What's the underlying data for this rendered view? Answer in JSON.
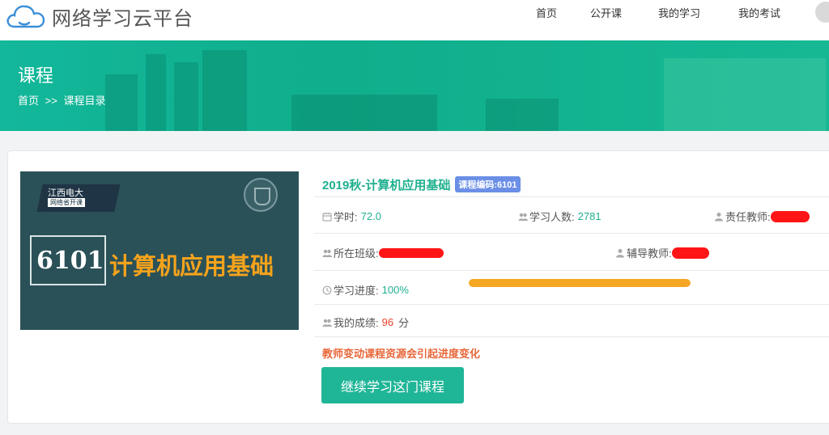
{
  "site": {
    "name": "网络学习云平台",
    "logo_icon": "cloud-icon"
  },
  "nav": {
    "items": [
      {
        "label": "首页"
      },
      {
        "label": "公开课"
      },
      {
        "label": "我的学习"
      },
      {
        "label": "我的考试"
      }
    ],
    "avatar_icon": "user-avatar-icon"
  },
  "banner": {
    "title": "课程",
    "breadcrumb": {
      "home": "首页",
      "separator": ">>",
      "current": "课程目录"
    }
  },
  "course": {
    "cover": {
      "school": "江西电大",
      "tag": "网络省开课",
      "code": "6101",
      "name": "计算机应用基础"
    },
    "title": "2019秋-计算机应用基础",
    "code_label": "课程编码:",
    "code": "6101",
    "hours_label": "学时:",
    "hours": "72.0",
    "students_label": "学习人数:",
    "students": "2781",
    "teacher_label": "责任教师:",
    "class_label": "所在班级:",
    "tutor_label": "辅导教师:",
    "progress_label": "学习进度:",
    "progress_text": "100%",
    "progress_value": 1.0,
    "score_label": "我的成绩:",
    "score": "96",
    "score_unit": "分",
    "notice": "教师变动课程资源会引起进度变化",
    "continue_button": "继续学习这门课程"
  },
  "colors": {
    "accent": "#1fb597",
    "progress": "#f5a623",
    "badge": "#6b8fe6",
    "notice": "#e8673a",
    "score": "#e8412c",
    "redaction": "#ff1515"
  },
  "icons": {
    "hours": "calendar-icon",
    "students": "users-icon",
    "teacher": "user-icon",
    "class": "users-icon",
    "tutor": "user-icon",
    "progress": "clock-icon",
    "score": "users-icon"
  }
}
